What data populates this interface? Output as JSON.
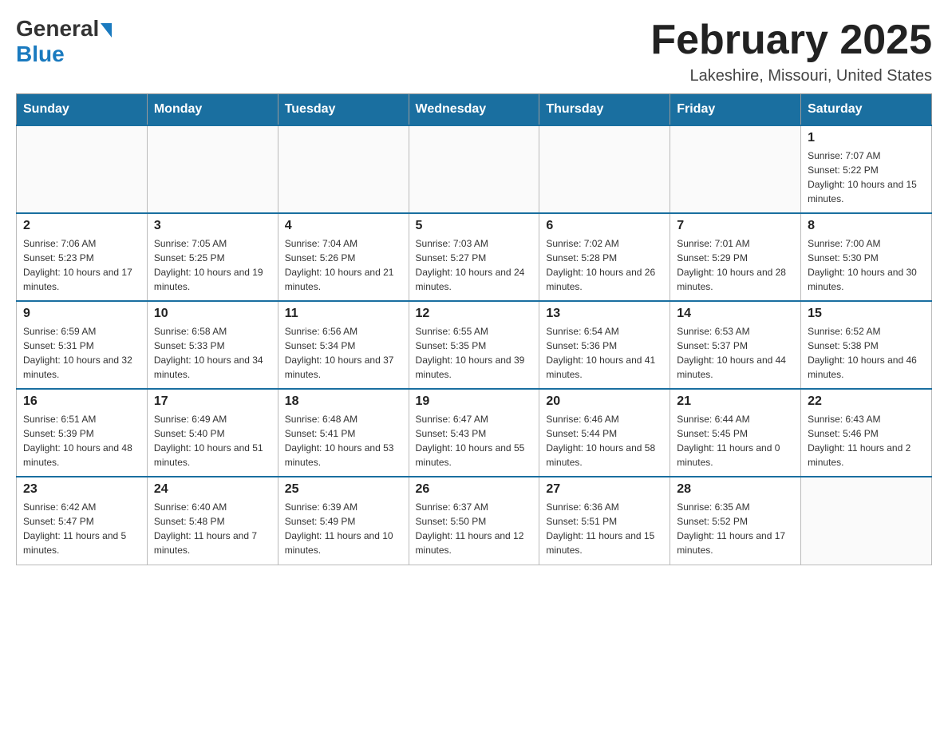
{
  "header": {
    "logo_general": "General",
    "logo_blue": "Blue",
    "month_title": "February 2025",
    "location": "Lakeshire, Missouri, United States"
  },
  "days_of_week": [
    "Sunday",
    "Monday",
    "Tuesday",
    "Wednesday",
    "Thursday",
    "Friday",
    "Saturday"
  ],
  "weeks": [
    [
      {
        "day": "",
        "sunrise": "",
        "sunset": "",
        "daylight": ""
      },
      {
        "day": "",
        "sunrise": "",
        "sunset": "",
        "daylight": ""
      },
      {
        "day": "",
        "sunrise": "",
        "sunset": "",
        "daylight": ""
      },
      {
        "day": "",
        "sunrise": "",
        "sunset": "",
        "daylight": ""
      },
      {
        "day": "",
        "sunrise": "",
        "sunset": "",
        "daylight": ""
      },
      {
        "day": "",
        "sunrise": "",
        "sunset": "",
        "daylight": ""
      },
      {
        "day": "1",
        "sunrise": "Sunrise: 7:07 AM",
        "sunset": "Sunset: 5:22 PM",
        "daylight": "Daylight: 10 hours and 15 minutes."
      }
    ],
    [
      {
        "day": "2",
        "sunrise": "Sunrise: 7:06 AM",
        "sunset": "Sunset: 5:23 PM",
        "daylight": "Daylight: 10 hours and 17 minutes."
      },
      {
        "day": "3",
        "sunrise": "Sunrise: 7:05 AM",
        "sunset": "Sunset: 5:25 PM",
        "daylight": "Daylight: 10 hours and 19 minutes."
      },
      {
        "day": "4",
        "sunrise": "Sunrise: 7:04 AM",
        "sunset": "Sunset: 5:26 PM",
        "daylight": "Daylight: 10 hours and 21 minutes."
      },
      {
        "day": "5",
        "sunrise": "Sunrise: 7:03 AM",
        "sunset": "Sunset: 5:27 PM",
        "daylight": "Daylight: 10 hours and 24 minutes."
      },
      {
        "day": "6",
        "sunrise": "Sunrise: 7:02 AM",
        "sunset": "Sunset: 5:28 PM",
        "daylight": "Daylight: 10 hours and 26 minutes."
      },
      {
        "day": "7",
        "sunrise": "Sunrise: 7:01 AM",
        "sunset": "Sunset: 5:29 PM",
        "daylight": "Daylight: 10 hours and 28 minutes."
      },
      {
        "day": "8",
        "sunrise": "Sunrise: 7:00 AM",
        "sunset": "Sunset: 5:30 PM",
        "daylight": "Daylight: 10 hours and 30 minutes."
      }
    ],
    [
      {
        "day": "9",
        "sunrise": "Sunrise: 6:59 AM",
        "sunset": "Sunset: 5:31 PM",
        "daylight": "Daylight: 10 hours and 32 minutes."
      },
      {
        "day": "10",
        "sunrise": "Sunrise: 6:58 AM",
        "sunset": "Sunset: 5:33 PM",
        "daylight": "Daylight: 10 hours and 34 minutes."
      },
      {
        "day": "11",
        "sunrise": "Sunrise: 6:56 AM",
        "sunset": "Sunset: 5:34 PM",
        "daylight": "Daylight: 10 hours and 37 minutes."
      },
      {
        "day": "12",
        "sunrise": "Sunrise: 6:55 AM",
        "sunset": "Sunset: 5:35 PM",
        "daylight": "Daylight: 10 hours and 39 minutes."
      },
      {
        "day": "13",
        "sunrise": "Sunrise: 6:54 AM",
        "sunset": "Sunset: 5:36 PM",
        "daylight": "Daylight: 10 hours and 41 minutes."
      },
      {
        "day": "14",
        "sunrise": "Sunrise: 6:53 AM",
        "sunset": "Sunset: 5:37 PM",
        "daylight": "Daylight: 10 hours and 44 minutes."
      },
      {
        "day": "15",
        "sunrise": "Sunrise: 6:52 AM",
        "sunset": "Sunset: 5:38 PM",
        "daylight": "Daylight: 10 hours and 46 minutes."
      }
    ],
    [
      {
        "day": "16",
        "sunrise": "Sunrise: 6:51 AM",
        "sunset": "Sunset: 5:39 PM",
        "daylight": "Daylight: 10 hours and 48 minutes."
      },
      {
        "day": "17",
        "sunrise": "Sunrise: 6:49 AM",
        "sunset": "Sunset: 5:40 PM",
        "daylight": "Daylight: 10 hours and 51 minutes."
      },
      {
        "day": "18",
        "sunrise": "Sunrise: 6:48 AM",
        "sunset": "Sunset: 5:41 PM",
        "daylight": "Daylight: 10 hours and 53 minutes."
      },
      {
        "day": "19",
        "sunrise": "Sunrise: 6:47 AM",
        "sunset": "Sunset: 5:43 PM",
        "daylight": "Daylight: 10 hours and 55 minutes."
      },
      {
        "day": "20",
        "sunrise": "Sunrise: 6:46 AM",
        "sunset": "Sunset: 5:44 PM",
        "daylight": "Daylight: 10 hours and 58 minutes."
      },
      {
        "day": "21",
        "sunrise": "Sunrise: 6:44 AM",
        "sunset": "Sunset: 5:45 PM",
        "daylight": "Daylight: 11 hours and 0 minutes."
      },
      {
        "day": "22",
        "sunrise": "Sunrise: 6:43 AM",
        "sunset": "Sunset: 5:46 PM",
        "daylight": "Daylight: 11 hours and 2 minutes."
      }
    ],
    [
      {
        "day": "23",
        "sunrise": "Sunrise: 6:42 AM",
        "sunset": "Sunset: 5:47 PM",
        "daylight": "Daylight: 11 hours and 5 minutes."
      },
      {
        "day": "24",
        "sunrise": "Sunrise: 6:40 AM",
        "sunset": "Sunset: 5:48 PM",
        "daylight": "Daylight: 11 hours and 7 minutes."
      },
      {
        "day": "25",
        "sunrise": "Sunrise: 6:39 AM",
        "sunset": "Sunset: 5:49 PM",
        "daylight": "Daylight: 11 hours and 10 minutes."
      },
      {
        "day": "26",
        "sunrise": "Sunrise: 6:37 AM",
        "sunset": "Sunset: 5:50 PM",
        "daylight": "Daylight: 11 hours and 12 minutes."
      },
      {
        "day": "27",
        "sunrise": "Sunrise: 6:36 AM",
        "sunset": "Sunset: 5:51 PM",
        "daylight": "Daylight: 11 hours and 15 minutes."
      },
      {
        "day": "28",
        "sunrise": "Sunrise: 6:35 AM",
        "sunset": "Sunset: 5:52 PM",
        "daylight": "Daylight: 11 hours and 17 minutes."
      },
      {
        "day": "",
        "sunrise": "",
        "sunset": "",
        "daylight": ""
      }
    ]
  ]
}
